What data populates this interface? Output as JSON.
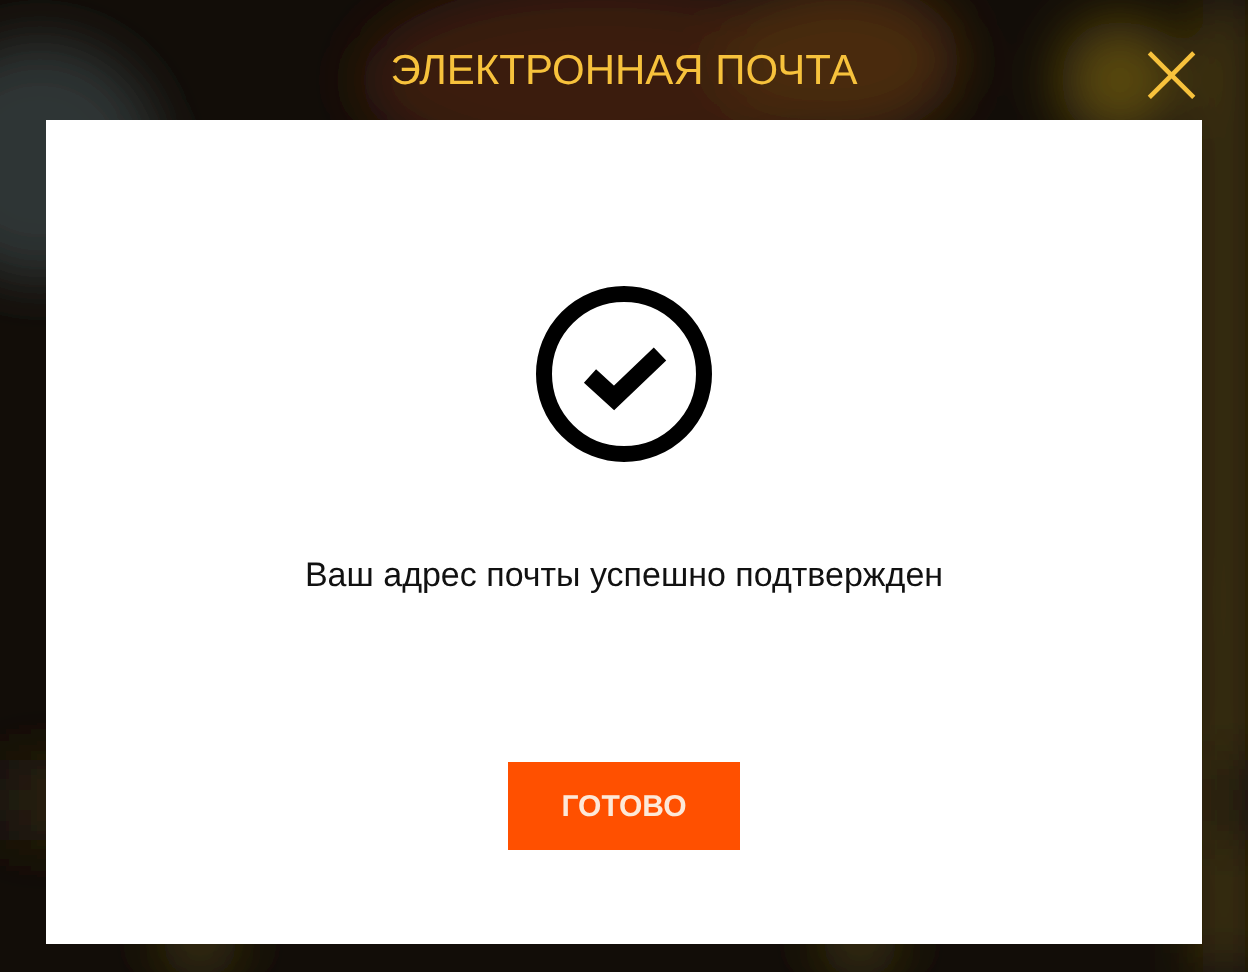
{
  "dialog": {
    "title": "ЭЛЕКТРОННАЯ ПОЧТА",
    "close": "×",
    "message": "Ваш адрес почты успешно подтвержден",
    "buttons": [
      "ГОТОВО"
    ]
  }
}
